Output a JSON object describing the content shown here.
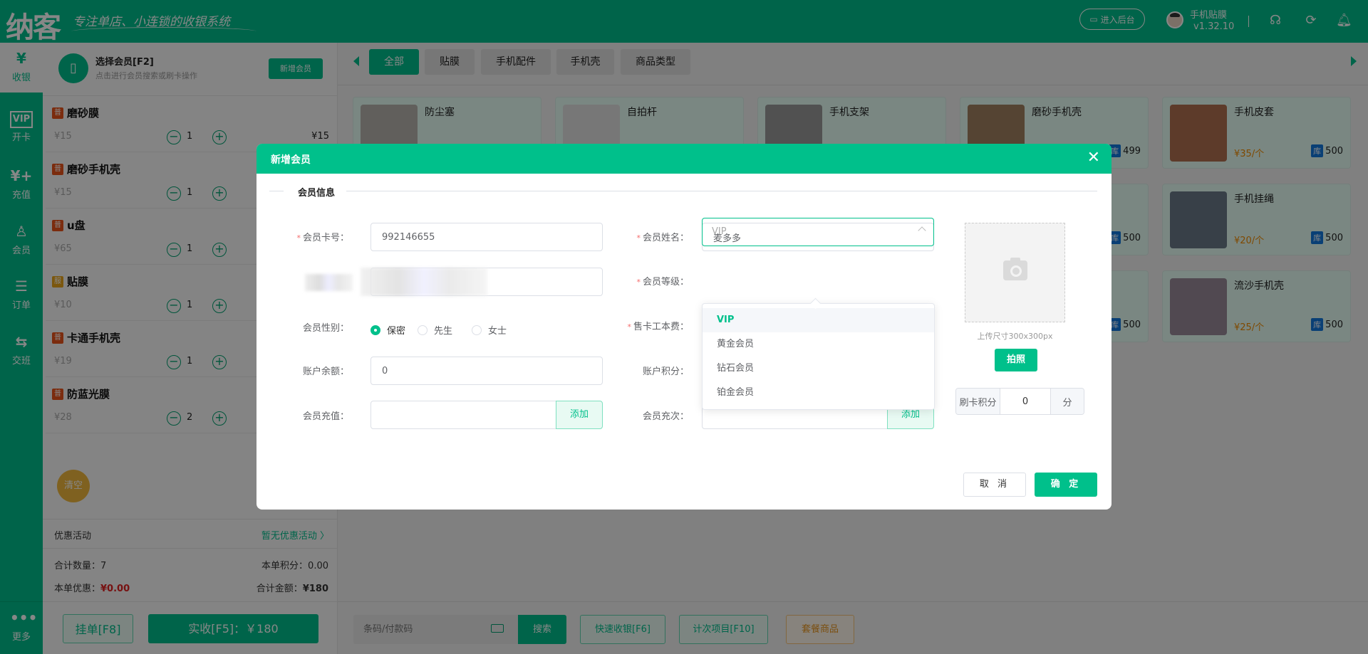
{
  "header": {
    "logo": "纳客",
    "slogan": "专注单店、小连锁的收银系统",
    "backend_button": "进入后台",
    "user_name": "手机贴膜",
    "version": "v1.32.10"
  },
  "sidebar": {
    "items": [
      {
        "label": "收银",
        "icon": "¥"
      },
      {
        "label": "开卡",
        "icon": "VIP"
      },
      {
        "label": "充值",
        "icon": "¥+"
      },
      {
        "label": "会员",
        "icon": "♙"
      },
      {
        "label": "订单",
        "icon": "☰"
      },
      {
        "label": "交班",
        "icon": "⇆"
      }
    ],
    "more": {
      "label": "更多",
      "icon": "•••"
    }
  },
  "member": {
    "title": "选择会员[F2]",
    "subtitle": "点击进行会员搜索或刷卡操作",
    "add_button": "新增会员"
  },
  "cart": [
    {
      "tag": "普",
      "tag_color": "#e8541c",
      "name": "磨砂膜",
      "price": "¥15",
      "qty": "1",
      "subtotal": "¥15"
    },
    {
      "tag": "普",
      "tag_color": "#e8541c",
      "name": "磨砂手机壳",
      "price": "¥15",
      "qty": "1",
      "subtotal": ""
    },
    {
      "tag": "普",
      "tag_color": "#e8541c",
      "name": "u盘",
      "price": "¥65",
      "qty": "1",
      "subtotal": ""
    },
    {
      "tag": "服",
      "tag_color": "#e8a41c",
      "name": "贴膜",
      "price": "¥10",
      "qty": "1",
      "subtotal": ""
    },
    {
      "tag": "普",
      "tag_color": "#e8541c",
      "name": "卡通手机壳",
      "price": "¥19",
      "qty": "1",
      "subtotal": ""
    },
    {
      "tag": "普",
      "tag_color": "#e8541c",
      "name": "防蓝光膜",
      "price": "¥28",
      "qty": "2",
      "subtotal": ""
    }
  ],
  "cart_actions": {
    "clear": "清空"
  },
  "promo": {
    "label": "优惠活动",
    "value": "暂无优惠活动 〉"
  },
  "summary": {
    "total_qty": "合计数量：7",
    "points": "本单积分：0.00",
    "discount_label": "本单优惠：",
    "discount_value": "¥0.00",
    "total_label": "合计金额：",
    "total_value": "¥180"
  },
  "footer_left": {
    "hold": "挂单[F8]",
    "pay": "实收[F5]：￥180"
  },
  "tabs": [
    "全部",
    "贴膜",
    "手机配件",
    "手机壳",
    "商品类型"
  ],
  "products": [
    {
      "name": "防尘塞",
      "price": "",
      "stock": ""
    },
    {
      "name": "自拍杆",
      "price": "",
      "stock": ""
    },
    {
      "name": "手机支架",
      "price": "",
      "stock": ""
    },
    {
      "name": "磨砂手机壳",
      "price": "",
      "stock": "499"
    },
    {
      "name": "手机皮套",
      "price": "¥35/个",
      "stock": "500"
    },
    {
      "name": "",
      "price": "",
      "stock": ""
    },
    {
      "name": "",
      "price": "",
      "stock": ""
    },
    {
      "name": "",
      "price": "",
      "stock": ""
    },
    {
      "name": "",
      "price": "",
      "stock": "500"
    },
    {
      "name": "手机挂绳",
      "price": "¥20/个",
      "stock": "500"
    },
    {
      "name": "",
      "price": "",
      "stock": ""
    },
    {
      "name": "",
      "price": "",
      "stock": ""
    },
    {
      "name": "",
      "price": "",
      "stock": ""
    },
    {
      "name": "",
      "price": "",
      "stock": "500"
    },
    {
      "name": "流沙手机壳",
      "price": "¥25/个",
      "stock": "500"
    }
  ],
  "stock_badge": "库",
  "bottom": {
    "barcode_placeholder": "条码/付款码",
    "search": "搜索",
    "quick_pay": "快速收银[F6]",
    "count_items": "计次项目[F10]",
    "package": "套餐商品"
  },
  "modal": {
    "title": "新增会员",
    "close": "✕",
    "section": "会员信息",
    "card_no_label": "会员卡号：",
    "card_no": "992146655",
    "name_label": "会员姓名：",
    "name": "麦多多",
    "level_label": "会员等级：",
    "level_placeholder": "VIP",
    "gender_label": "会员性别：",
    "genders": [
      "保密",
      "先生",
      "女士"
    ],
    "fee_label": "售卡工本费：",
    "balance_label": "账户余额：",
    "balance": "0",
    "points_label": "账户积分：",
    "recharge_label": "会员充值：",
    "recharge_times_label": "会员充次：",
    "add": "添加",
    "level_options": [
      "VIP",
      "黄金会员",
      "钻石会员",
      "铂金会员"
    ],
    "photo_hint": "上传尺寸300x300px",
    "photo_button": "拍照",
    "swipe_points_label": "刷卡积分",
    "swipe_points": "0",
    "points_unit": "分",
    "cancel": "取 消",
    "confirm": "确 定"
  }
}
